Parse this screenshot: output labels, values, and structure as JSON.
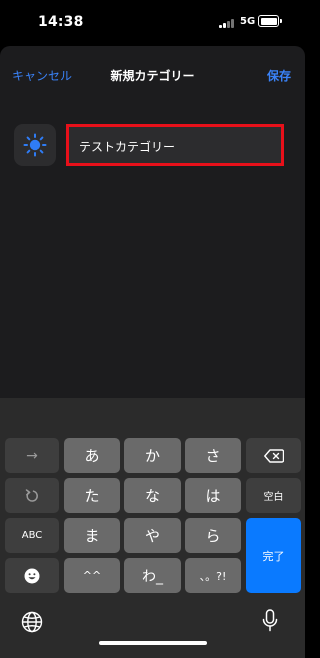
{
  "status_bar": {
    "time": "14:38",
    "network": "5G"
  },
  "nav": {
    "cancel_label": "キャンセル",
    "title": "新規カテゴリー",
    "save_label": "保存"
  },
  "category": {
    "icon": "sun-icon",
    "icon_color": "#2f7cf6",
    "name_value": "テストカテゴリー",
    "highlight_color": "#e8101a"
  },
  "keyboard": {
    "row1": {
      "arrow": "→",
      "keys": [
        "あ",
        "か",
        "さ"
      ]
    },
    "row2": {
      "keys": [
        "た",
        "な",
        "は"
      ],
      "space": "空白"
    },
    "row3": {
      "abc": "ABC",
      "keys": [
        "ま",
        "や",
        "ら"
      ]
    },
    "row4": {
      "keys": [
        "^^",
        "わ_",
        "、。?!"
      ]
    },
    "done_label": "完了"
  }
}
